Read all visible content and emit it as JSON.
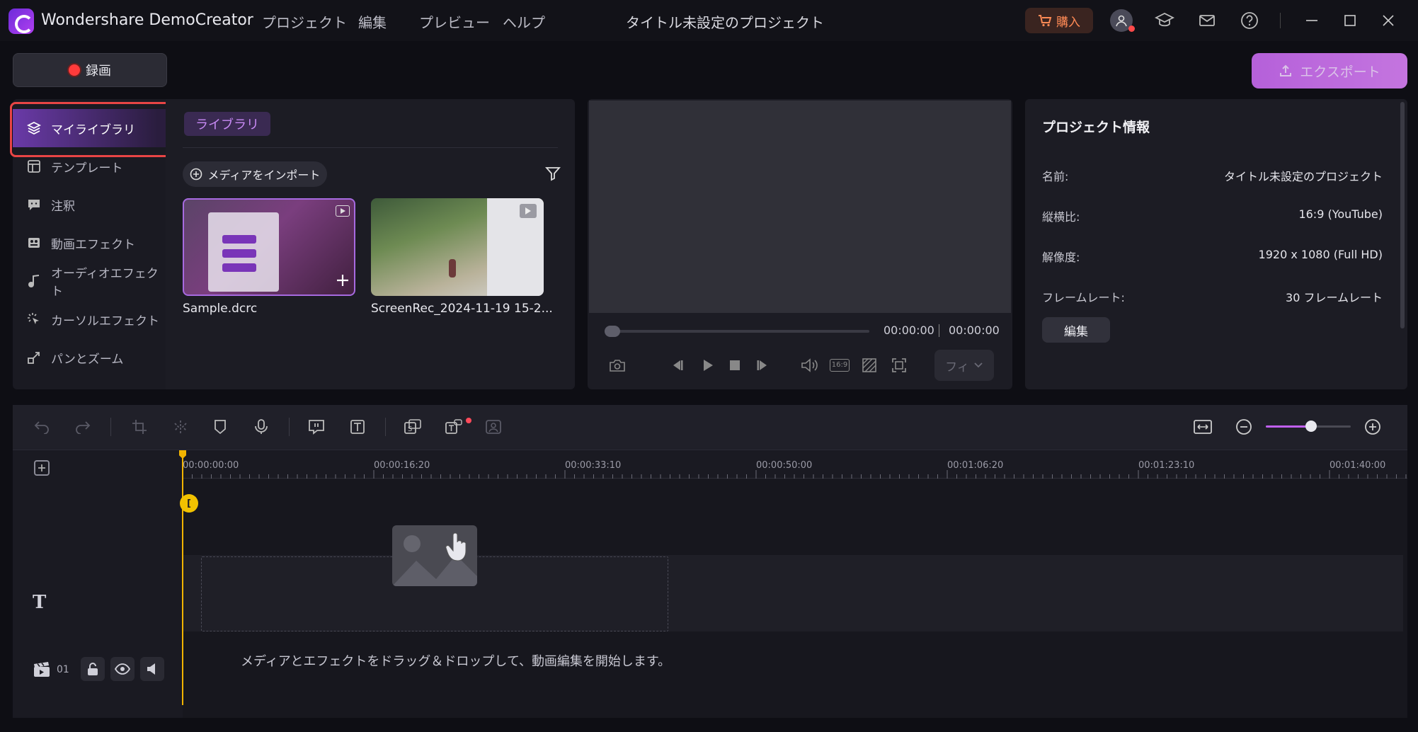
{
  "app": {
    "name": "Wondershare DemoCreator",
    "project_title": "タイトル未設定のプロジェクト",
    "menu": [
      "プロジェクト",
      "編集",
      "プレビュー",
      "ヘルプ"
    ],
    "buy_label": "購入"
  },
  "actions": {
    "record_label": "録画",
    "export_label": "エクスポート"
  },
  "sidebar": {
    "items": [
      {
        "label": "マイライブラリ",
        "icon": "layers-icon",
        "active": true
      },
      {
        "label": "テンプレート",
        "icon": "template-icon"
      },
      {
        "label": "注釈",
        "icon": "annotation-icon"
      },
      {
        "label": "動画エフェクト",
        "icon": "video-effect-icon"
      },
      {
        "label": "オーディオエフェクト",
        "icon": "audio-effect-icon"
      },
      {
        "label": "カーソルエフェクト",
        "icon": "cursor-effect-icon"
      },
      {
        "label": "パンとズーム",
        "icon": "pan-zoom-icon"
      }
    ]
  },
  "library": {
    "tab_label": "ライブラリ",
    "import_label": "メディアをインポート",
    "media": [
      {
        "name": "Sample.dcrc",
        "selected": true
      },
      {
        "name": "ScreenRec_2024-11-19 15-2..."
      }
    ]
  },
  "preview": {
    "time_current": "00:00:00",
    "time_total": "00:00:00",
    "aspect_label": "16:9",
    "fit_label": "フィ"
  },
  "project_info": {
    "title": "プロジェクト情報",
    "rows": [
      {
        "label": "名前:",
        "value": "タイトル未設定のプロジェクト"
      },
      {
        "label": "縦横比:",
        "value": "16:9 (YouTube)"
      },
      {
        "label": "解像度:",
        "value": "1920 x 1080 (Full HD)"
      },
      {
        "label": "フレームレート:",
        "value": "30 フレームレート"
      }
    ],
    "edit_label": "編集"
  },
  "timeline": {
    "ruler_labels": [
      "00:00:00:00",
      "00:00:16:20",
      "00:00:33:10",
      "00:00:50:00",
      "00:01:06:20",
      "00:01:23:10",
      "00:01:40:00"
    ],
    "track_number": "01",
    "drop_hint": "メディアとエフェクトをドラッグ＆ドロップして、動画編集を開始します。",
    "zoom_level": 0.53,
    "text_track_glyph": "T"
  },
  "colors": {
    "accent": "#c060f0",
    "record": "#ff3b3b",
    "playhead": "#f2b400",
    "buy": "#ff8a55"
  }
}
